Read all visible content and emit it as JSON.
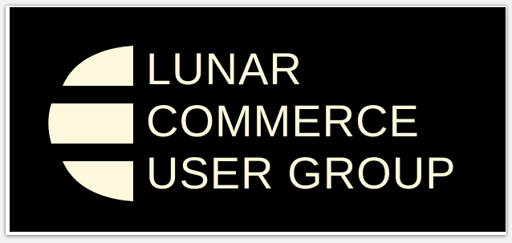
{
  "brand": {
    "lines": [
      "LUNAR",
      "COMMERCE",
      "USER GROUP"
    ]
  },
  "colors": {
    "background": "#000000",
    "foreground": "#fff8dc"
  },
  "icons": {
    "logo": "moon-stripes-icon"
  }
}
